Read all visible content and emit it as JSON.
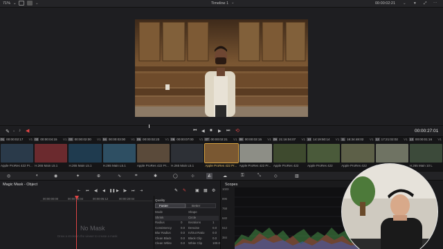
{
  "topbar": {
    "zoom": "71%",
    "timeline": "Timeline 1",
    "timecode": "00:00:02:21"
  },
  "transport": {
    "timecode": "00:00:27:01"
  },
  "clips": [
    {
      "num": "01",
      "tc": "00:00:02:17",
      "track": "V1",
      "name": "Apple ProRes 422 Pr...",
      "color": "#2a3a4a"
    },
    {
      "num": "02",
      "tc": "00:00:04:15",
      "track": "V1",
      "name": "H.265 Main L5.1",
      "color": "#6b2a2e"
    },
    {
      "num": "03",
      "tc": "00:00:02:00",
      "track": "V1",
      "name": "H.265 Main L5.1",
      "color": "#1f3b4f"
    },
    {
      "num": "04",
      "tc": "00:00:03:00",
      "track": "V1",
      "name": "H.265 Main L5.1",
      "color": "#2e4f63"
    },
    {
      "num": "05",
      "tc": "00:00:02:23",
      "track": "V1",
      "name": "Apple ProRes 422 Pr...",
      "color": "#5a4a3a"
    },
    {
      "num": "06",
      "tc": "00:00:07:00",
      "track": "V1",
      "name": "H.265 Main L5.1",
      "color": "#2d3036"
    },
    {
      "num": "07",
      "tc": "00:00:02:21",
      "track": "V1",
      "name": "Apple ProRes 422 Pr...",
      "color": "#7a5832"
    },
    {
      "num": "08",
      "tc": "00:00:03:15",
      "track": "V1",
      "name": "Apple ProRes 422 Pr...",
      "color": "#8d8e86"
    },
    {
      "num": "09",
      "tc": "21:16:04:07",
      "track": "V1",
      "name": "Apple ProRes 422",
      "color": "#3e4a2e"
    },
    {
      "num": "10",
      "tc": "14:19:50:14",
      "track": "V1",
      "name": "Apple ProRes 422",
      "color": "#4a5a3a"
    },
    {
      "num": "11",
      "tc": "16:34:48:02",
      "track": "V1",
      "name": "Apple ProRes 422",
      "color": "#5d6048"
    },
    {
      "num": "12",
      "tc": "17:21:02:02",
      "track": "V1",
      "name": "Apple ProRes 422",
      "color": "#6f7363"
    },
    {
      "num": "13",
      "tc": "00:00:01:16",
      "track": "V1",
      "name": "H.265 Main 10 L",
      "color": "#3c4a3a"
    }
  ],
  "mask": {
    "title": "Magic Mask - Object",
    "ruler": [
      "00:00:00:00",
      "00:00:02:04",
      "00:00:05:12",
      "00:00:20:04"
    ],
    "empty_title": "No Mask",
    "empty_hint": "Draw a stroke in the viewer to create a mask"
  },
  "quality": {
    "label": "Quality",
    "faster": "Faster",
    "better": "Better",
    "rows": [
      {
        "l": "Mode",
        "r": "Shape"
      },
      {
        "l": "Shrink",
        "r": "Circle",
        "boxed": true
      },
      {
        "l": "Radius",
        "lv": "0",
        "r": "Iterations",
        "rv": "1"
      },
      {
        "l": "Consistency",
        "lv": "0.0",
        "r": "Denoise",
        "rv": "0.0"
      },
      {
        "l": "Blur Radius",
        "lv": "0.0",
        "r": "In/Out Ratio",
        "rv": "0.0"
      },
      {
        "l": "Clean Black",
        "lv": "0.0",
        "r": "Black Clip",
        "rv": "0.0"
      },
      {
        "l": "Clean White",
        "lv": "0.0",
        "r": "White Clip",
        "rv": "100.0"
      }
    ]
  },
  "scopes": {
    "title": "Scopes",
    "scale": [
      "1023",
      "896",
      "768",
      "640",
      "512",
      "384"
    ]
  }
}
